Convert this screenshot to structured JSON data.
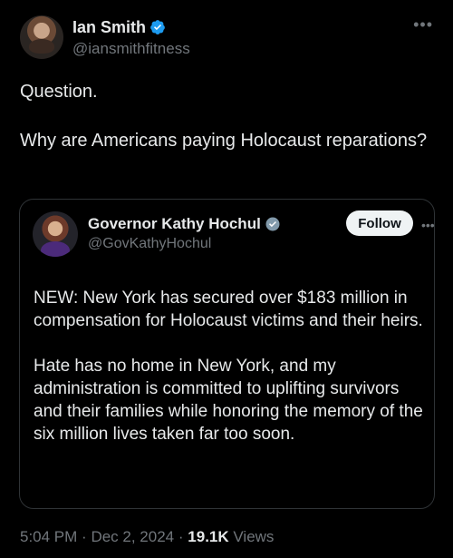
{
  "tweet": {
    "author": {
      "display_name": "Ian Smith",
      "handle": "@iansmithfitness",
      "verified": true
    },
    "text_lines": [
      "Question.",
      "Why are Americans paying Holocaust reparations?"
    ],
    "quote": {
      "author": {
        "display_name": "Governor Kathy Hochul",
        "handle": "@GovKathyHochul",
        "verified": true
      },
      "follow_label": "Follow",
      "paragraphs": [
        "NEW: New York has secured over $183 million in compensation for Holocaust victims and their heirs.",
        "Hate has no home in New York, and my administration is committed to uplifting survivors and their families while honoring the memory of the six million lives taken far too soon."
      ]
    },
    "meta": {
      "time": "5:04 PM",
      "separator": "·",
      "date": "Dec 2, 2024",
      "views_count": "19.1K",
      "views_label": "Views"
    }
  },
  "icons": {
    "more": "more-horizontal-icon",
    "verified": "verified-badge-icon"
  },
  "colors": {
    "background": "#000000",
    "text": "#e7e9ea",
    "muted": "#71767b",
    "border": "#2f3336",
    "verified": "#1d9bf0",
    "follow_bg": "#eff3f4"
  }
}
